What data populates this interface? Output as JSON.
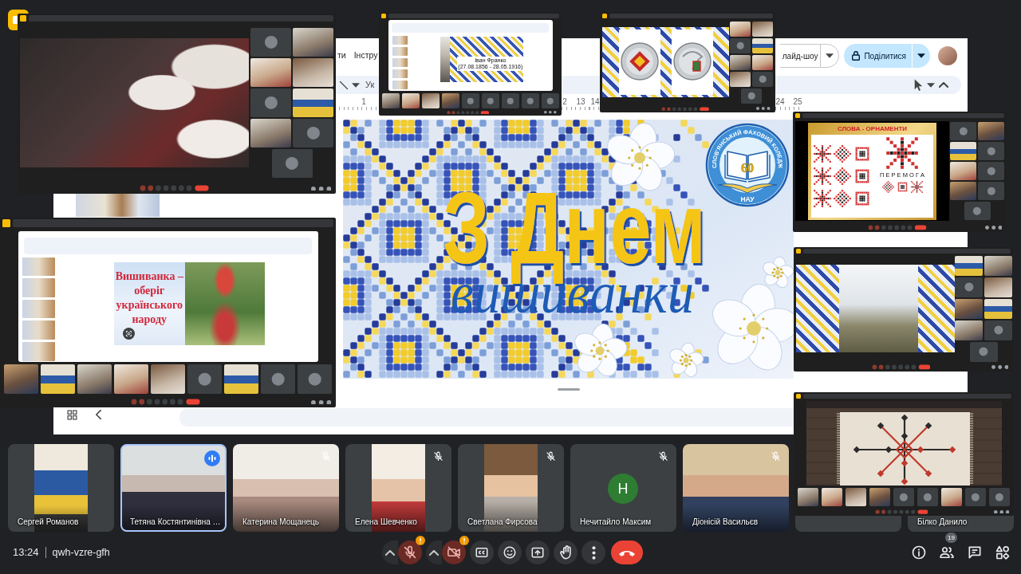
{
  "meeting": {
    "time": "13:24",
    "code": "qwh-vzre-gfh"
  },
  "shared_screen": {
    "menu": [
      "ти",
      "Інстру"
    ],
    "toolbar_text": "Ук",
    "slideshow_button": "лайд-шоу",
    "share_button": "Поділитися",
    "ruler": [
      "1",
      "2",
      "13",
      "14",
      "24",
      "25"
    ],
    "slide": {
      "title": "З Днем",
      "subtitle": "вишиванки",
      "logo": {
        "ring_text": "СЛОВ'ЯНСЬКИЙ ФАХОВИЙ КОЛЕДЖ",
        "number": "60",
        "footer": "НАУ"
      }
    }
  },
  "screenshots": [
    {
      "kind": "side-tiles",
      "content": {
        "kind": "photo"
      },
      "tiles": [
        {
          "kind": "avatar"
        },
        {
          "kind": "video"
        },
        {
          "kind": "video"
        },
        {
          "kind": "video"
        },
        {
          "kind": "avatar"
        },
        {
          "kind": "video"
        },
        {
          "kind": "video"
        },
        {
          "kind": "avatar"
        },
        {
          "kind": "avatar"
        }
      ]
    },
    {
      "kind": "bottom-tiles",
      "content": {
        "kind": "editor-caption",
        "lines": [
          "Іван Франко",
          "(27.08.1856 - 28.05.1916)"
        ]
      },
      "tiles": [
        {
          "kind": "video"
        },
        {
          "kind": "video"
        },
        {
          "kind": "video"
        },
        {
          "kind": "video"
        },
        {
          "kind": "avatar"
        },
        {
          "kind": "avatar"
        },
        {
          "kind": "avatar"
        },
        {
          "kind": "avatar"
        },
        {
          "kind": "avatar"
        }
      ]
    },
    {
      "kind": "side-tiles",
      "content": {
        "kind": "coins"
      },
      "tiles": [
        {
          "kind": "video"
        },
        {
          "kind": "video"
        },
        {
          "kind": "avatar"
        },
        {
          "kind": "video"
        },
        {
          "kind": "video"
        },
        {
          "kind": "video"
        },
        {
          "kind": "video"
        },
        {
          "kind": "avatar"
        },
        {
          "kind": "avatar"
        }
      ]
    },
    {
      "kind": "side-tiles",
      "content": {
        "kind": "ornaments",
        "title": "СЛОВА - ОРНАМЕНТИ",
        "caption": "П Е Р Е М О Г А"
      },
      "tiles": [
        {
          "kind": "avatar"
        },
        {
          "kind": "video"
        },
        {
          "kind": "video"
        },
        {
          "kind": "avatar"
        },
        {
          "kind": "video"
        },
        {
          "kind": "avatar"
        },
        {
          "kind": "video"
        },
        {
          "kind": "avatar"
        },
        {
          "kind": "avatar"
        }
      ]
    },
    {
      "kind": "bottom-tiles",
      "content": {
        "kind": "editor",
        "lines": [
          "Вишиванка –",
          "оберіг",
          "українського",
          "народу"
        ]
      },
      "tiles": [
        {
          "kind": "video"
        },
        {
          "kind": "video"
        },
        {
          "kind": "video"
        },
        {
          "kind": "video"
        },
        {
          "kind": "video"
        },
        {
          "kind": "avatar"
        },
        {
          "kind": "video"
        },
        {
          "kind": "avatar"
        },
        {
          "kind": "avatar"
        }
      ]
    },
    {
      "kind": "side-tiles",
      "content": {
        "kind": "framed-photo"
      },
      "tiles": [
        {
          "kind": "video"
        },
        {
          "kind": "video"
        },
        {
          "kind": "avatar"
        },
        {
          "kind": "video"
        },
        {
          "kind": "video"
        },
        {
          "kind": "video"
        },
        {
          "kind": "video"
        },
        {
          "kind": "avatar"
        },
        {
          "kind": "avatar"
        }
      ]
    },
    {
      "kind": "bottom-tiles",
      "content": {
        "kind": "rushnyk"
      },
      "tiles": [
        {
          "kind": "video"
        },
        {
          "kind": "video"
        },
        {
          "kind": "video"
        },
        {
          "kind": "video"
        },
        {
          "kind": "avatar"
        },
        {
          "kind": "avatar"
        },
        {
          "kind": "video"
        },
        {
          "kind": "avatar"
        },
        {
          "kind": "avatar"
        }
      ]
    }
  ],
  "participants": [
    {
      "name": "Сергей Романов",
      "kind": "portrait-video",
      "muted": false,
      "speaking": false
    },
    {
      "name": "Тетяна Костянтинівна …",
      "kind": "video",
      "muted": false,
      "speaking": true
    },
    {
      "name": "Катерина Мощанець",
      "kind": "video",
      "muted": true,
      "speaking": false
    },
    {
      "name": "Елена Шевченко",
      "kind": "portrait-video",
      "muted": true,
      "speaking": false
    },
    {
      "name": "Светлана Фирсова",
      "kind": "portrait-video",
      "muted": true,
      "speaking": false
    },
    {
      "name": "Нечитайло Максим",
      "kind": "avatar",
      "initial": "Н",
      "muted": true,
      "speaking": false
    },
    {
      "name": "Діонісій Васильєв",
      "kind": "video",
      "muted": true,
      "speaking": false
    },
    {
      "kind": "covered"
    },
    {
      "name": "Білко Данило",
      "kind": "covered"
    }
  ],
  "controls": [
    {
      "kind": "mic",
      "on": false,
      "alert": true
    },
    {
      "kind": "camera",
      "on": false,
      "alert": true
    },
    {
      "kind": "captions"
    },
    {
      "kind": "reactions"
    },
    {
      "kind": "present"
    },
    {
      "kind": "hand"
    },
    {
      "kind": "more"
    },
    {
      "kind": "leave"
    }
  ],
  "side_controls": [
    {
      "kind": "info"
    },
    {
      "kind": "people",
      "badge": "19"
    },
    {
      "kind": "chat"
    },
    {
      "kind": "activities"
    }
  ]
}
